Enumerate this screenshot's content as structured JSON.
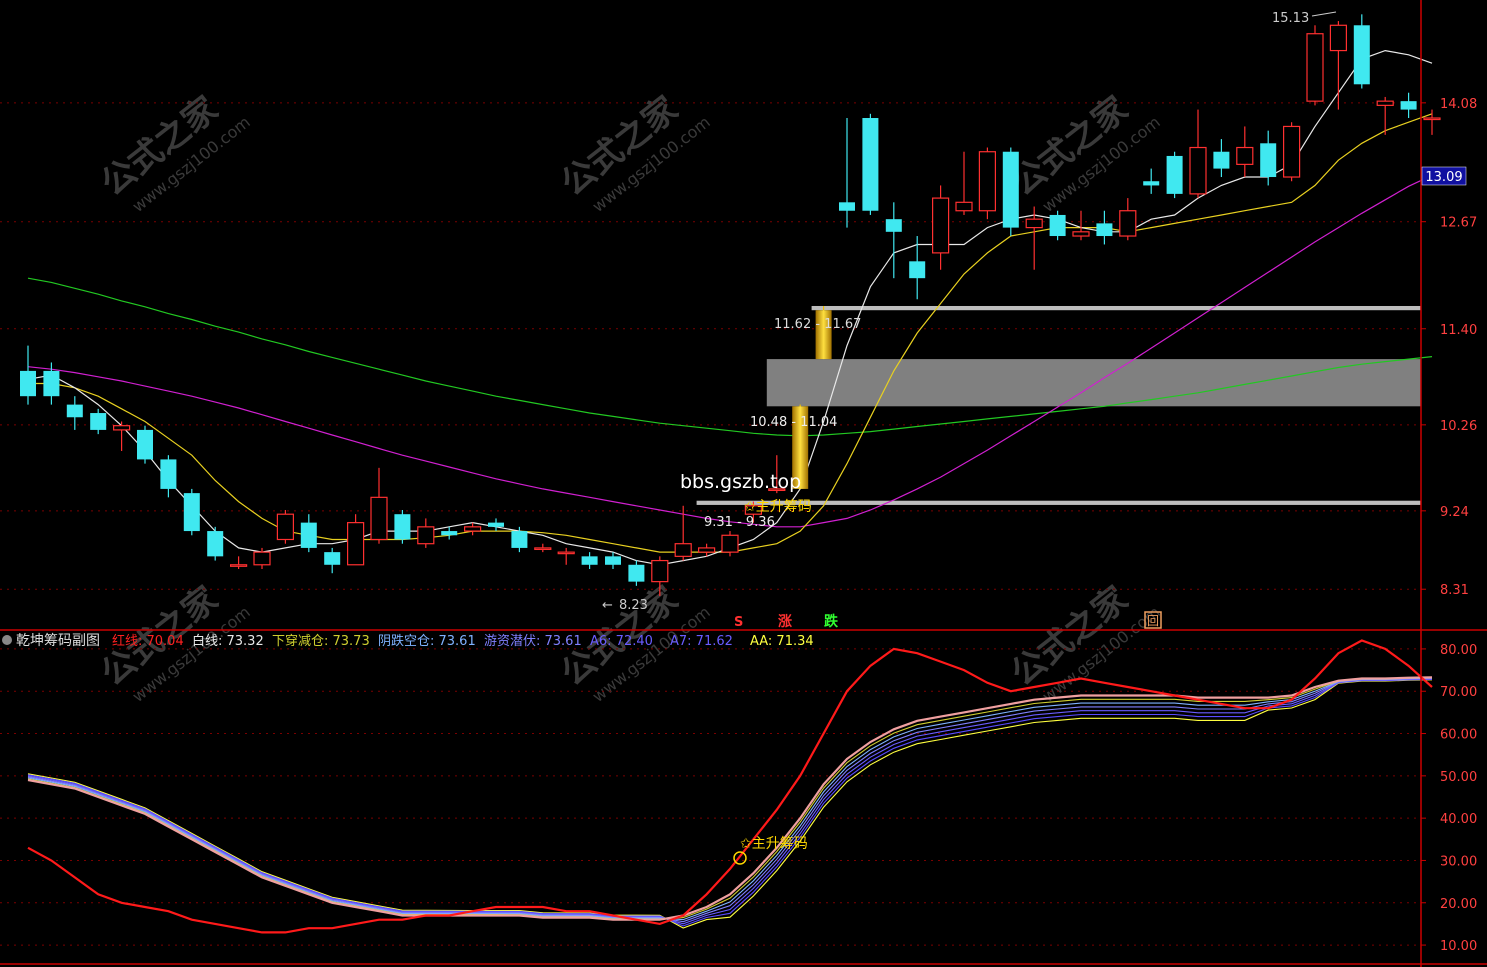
{
  "main": {
    "y_ticks": [
      "14.08",
      "12.67",
      "11.40",
      "10.26",
      "9.24",
      "8.31"
    ],
    "current_price": "13.09",
    "high_label": "15.13",
    "low_label": "8.23",
    "zone_top_label": "11.62 - 11.67",
    "zone_mid_label": "10.48 - 11.04",
    "zone_low_label": "9.31 - 9.36",
    "signal_label": "✩主升筹码",
    "site_text": "bbs.gszb.top",
    "badge_s": "S",
    "badge_up": "涨",
    "badge_down": "跌",
    "badge_back": "回"
  },
  "sub": {
    "title": "乾坤筹码副图",
    "legend": [
      {
        "name": "红线",
        "value": "70.04",
        "color": "#ff2020"
      },
      {
        "name": "白线",
        "value": "73.32",
        "color": "#e8e8e8"
      },
      {
        "name": "下穿减仓",
        "value": "73.73",
        "color": "#cfcf30"
      },
      {
        "name": "阴跌空仓",
        "value": "73.61",
        "color": "#7fb2ff"
      },
      {
        "name": "游资潜伏",
        "value": "73.61",
        "color": "#8080ff"
      },
      {
        "name": "A6",
        "value": "72.40",
        "color": "#6a5cff"
      },
      {
        "name": "A7",
        "value": "71.62",
        "color": "#6a5cff"
      },
      {
        "name": "AA",
        "value": "71.34",
        "color": "#ffff40"
      }
    ],
    "y_ticks": [
      "80.00",
      "70.00",
      "60.00",
      "50.00",
      "40.00",
      "30.00",
      "20.00",
      "10.00"
    ],
    "signal_label": "✩主升筹码"
  },
  "watermark": {
    "brand": "公式之家",
    "url": "www.gszj100.com"
  },
  "chart_data": [
    {
      "type": "candlestick",
      "title": "",
      "y_ticks": [
        14.08,
        12.67,
        11.4,
        10.26,
        9.24,
        8.31
      ],
      "ylim": [
        7.85,
        15.3
      ],
      "high": 15.13,
      "low": 8.23,
      "last": 13.09,
      "zones": [
        [
          11.62,
          11.67
        ],
        [
          10.48,
          11.04
        ],
        [
          9.31,
          9.36
        ]
      ],
      "candles": [
        [
          10.9,
          10.6,
          11.2,
          10.5
        ],
        [
          10.9,
          10.6,
          11.0,
          10.5
        ],
        [
          10.5,
          10.35,
          10.6,
          10.2
        ],
        [
          10.4,
          10.2,
          10.45,
          10.15
        ],
        [
          10.2,
          10.25,
          10.3,
          9.95
        ],
        [
          10.2,
          9.85,
          10.25,
          9.8
        ],
        [
          9.85,
          9.5,
          9.9,
          9.4
        ],
        [
          9.45,
          9.0,
          9.5,
          8.95
        ],
        [
          9.0,
          8.7,
          9.05,
          8.65
        ],
        [
          8.6,
          8.6,
          8.7,
          8.55
        ],
        [
          8.6,
          8.75,
          8.8,
          8.55
        ],
        [
          8.9,
          9.2,
          9.25,
          8.85
        ],
        [
          9.1,
          8.8,
          9.2,
          8.75
        ],
        [
          8.75,
          8.6,
          8.8,
          8.5
        ],
        [
          8.6,
          9.1,
          9.2,
          8.6
        ],
        [
          8.9,
          9.4,
          9.75,
          8.85
        ],
        [
          9.2,
          8.9,
          9.25,
          8.85
        ],
        [
          8.85,
          9.05,
          9.15,
          8.8
        ],
        [
          9.0,
          8.95,
          9.05,
          8.9
        ],
        [
          9.0,
          9.05,
          9.1,
          8.95
        ],
        [
          9.1,
          9.05,
          9.15,
          9.0
        ],
        [
          9.0,
          8.8,
          9.05,
          8.75
        ],
        [
          8.8,
          8.8,
          8.85,
          8.75
        ],
        [
          8.75,
          8.75,
          8.8,
          8.6
        ],
        [
          8.7,
          8.6,
          8.75,
          8.55
        ],
        [
          8.7,
          8.6,
          8.75,
          8.55
        ],
        [
          8.6,
          8.4,
          8.65,
          8.35
        ],
        [
          8.4,
          8.65,
          8.7,
          8.23
        ],
        [
          8.7,
          8.85,
          9.3,
          8.65
        ],
        [
          8.75,
          8.8,
          8.85,
          8.7
        ],
        [
          8.75,
          8.95,
          9.0,
          8.7
        ],
        [
          9.2,
          9.3,
          9.35,
          9.1
        ],
        [
          9.5,
          9.5,
          9.9,
          9.45
        ],
        [
          9.5,
          10.48,
          10.5,
          9.5
        ],
        [
          11.04,
          11.62,
          11.67,
          11.04
        ],
        [
          12.9,
          12.8,
          13.9,
          12.6
        ],
        [
          13.9,
          12.8,
          13.95,
          12.75
        ],
        [
          12.7,
          12.55,
          12.9,
          12.0
        ],
        [
          12.2,
          12.0,
          12.5,
          11.75
        ],
        [
          12.3,
          12.95,
          13.1,
          12.1
        ],
        [
          12.8,
          12.9,
          13.5,
          12.75
        ],
        [
          12.8,
          13.5,
          13.55,
          12.7
        ],
        [
          13.5,
          12.6,
          13.55,
          12.5
        ],
        [
          12.6,
          12.7,
          12.85,
          12.1
        ],
        [
          12.75,
          12.5,
          12.8,
          12.45
        ],
        [
          12.5,
          12.55,
          12.8,
          12.45
        ],
        [
          12.65,
          12.5,
          12.8,
          12.4
        ],
        [
          12.5,
          12.8,
          12.95,
          12.45
        ],
        [
          13.15,
          13.1,
          13.3,
          13.0
        ],
        [
          13.45,
          13.0,
          13.5,
          12.95
        ],
        [
          13.0,
          13.55,
          14.0,
          12.95
        ],
        [
          13.5,
          13.3,
          13.65,
          13.2
        ],
        [
          13.35,
          13.55,
          13.8,
          13.2
        ],
        [
          13.6,
          13.2,
          13.75,
          13.1
        ],
        [
          13.2,
          13.8,
          13.85,
          13.15
        ],
        [
          14.1,
          14.9,
          15.0,
          14.05
        ],
        [
          14.7,
          15.0,
          15.05,
          14.0
        ],
        [
          15.0,
          14.3,
          15.13,
          14.25
        ],
        [
          14.05,
          14.1,
          14.15,
          13.7
        ],
        [
          14.1,
          14.0,
          14.2,
          13.9
        ],
        [
          13.9,
          13.9,
          14.0,
          13.7
        ]
      ],
      "ma_white": [
        10.8,
        10.85,
        10.7,
        10.5,
        10.25,
        9.95,
        9.6,
        9.3,
        9.0,
        8.8,
        8.75,
        8.8,
        8.85,
        8.85,
        8.9,
        9.0,
        9.0,
        9.0,
        9.05,
        9.1,
        9.05,
        9.0,
        8.95,
        8.85,
        8.8,
        8.75,
        8.65,
        8.6,
        8.65,
        8.7,
        8.8,
        8.9,
        9.1,
        9.5,
        10.3,
        11.2,
        11.9,
        12.3,
        12.4,
        12.4,
        12.4,
        12.6,
        12.7,
        12.75,
        12.7,
        12.6,
        12.55,
        12.55,
        12.7,
        12.75,
        12.95,
        13.1,
        13.2,
        13.2,
        13.35,
        13.8,
        14.2,
        14.6,
        14.7,
        14.65,
        14.55
      ],
      "ma_yellow": [
        10.75,
        10.75,
        10.7,
        10.6,
        10.45,
        10.3,
        10.1,
        9.9,
        9.6,
        9.35,
        9.15,
        9.0,
        8.95,
        8.9,
        8.9,
        8.9,
        8.9,
        8.92,
        8.95,
        9.0,
        9.0,
        9.0,
        8.98,
        8.95,
        8.9,
        8.85,
        8.8,
        8.75,
        8.75,
        8.75,
        8.75,
        8.8,
        8.85,
        9.0,
        9.3,
        9.8,
        10.35,
        10.9,
        11.35,
        11.7,
        12.05,
        12.3,
        12.5,
        12.55,
        12.6,
        12.6,
        12.6,
        12.55,
        12.6,
        12.65,
        12.7,
        12.75,
        12.8,
        12.85,
        12.9,
        13.1,
        13.4,
        13.6,
        13.75,
        13.85,
        13.95
      ],
      "ma_magenta": [
        10.95,
        10.92,
        10.88,
        10.83,
        10.78,
        10.72,
        10.66,
        10.6,
        10.53,
        10.46,
        10.38,
        10.3,
        10.22,
        10.14,
        10.06,
        9.98,
        9.9,
        9.83,
        9.76,
        9.69,
        9.62,
        9.56,
        9.5,
        9.45,
        9.4,
        9.35,
        9.3,
        9.25,
        9.2,
        9.15,
        9.11,
        9.08,
        9.05,
        9.05,
        9.1,
        9.15,
        9.25,
        9.37,
        9.5,
        9.64,
        9.8,
        9.96,
        10.13,
        10.3,
        10.47,
        10.64,
        10.82,
        10.99,
        11.17,
        11.35,
        11.53,
        11.71,
        11.89,
        12.07,
        12.25,
        12.43,
        12.6,
        12.77,
        12.93,
        13.09,
        13.22
      ],
      "ma_green": [
        12.0,
        11.95,
        11.88,
        11.81,
        11.73,
        11.66,
        11.58,
        11.51,
        11.43,
        11.36,
        11.28,
        11.21,
        11.13,
        11.06,
        10.99,
        10.92,
        10.85,
        10.78,
        10.72,
        10.66,
        10.6,
        10.55,
        10.5,
        10.45,
        10.4,
        10.36,
        10.32,
        10.28,
        10.25,
        10.22,
        10.19,
        10.16,
        10.14,
        10.13,
        10.14,
        10.16,
        10.18,
        10.21,
        10.24,
        10.27,
        10.3,
        10.33,
        10.36,
        10.39,
        10.42,
        10.45,
        10.48,
        10.52,
        10.56,
        10.6,
        10.64,
        10.69,
        10.74,
        10.79,
        10.84,
        10.89,
        10.94,
        10.98,
        11.01,
        11.04,
        11.07
      ]
    },
    {
      "type": "line",
      "title": "乾坤筹码副图",
      "y_ticks": [
        80,
        70,
        60,
        50,
        40,
        30,
        20,
        10
      ],
      "ylim": [
        6,
        84
      ],
      "red": [
        33,
        30,
        26,
        22,
        20,
        19,
        18,
        16,
        15,
        14,
        13,
        13,
        14,
        14,
        15,
        16,
        16,
        17,
        17,
        18,
        19,
        19,
        19,
        18,
        18,
        17,
        16,
        15,
        17,
        22,
        28,
        35,
        42,
        50,
        60,
        70,
        76,
        80,
        79,
        77,
        75,
        72,
        70,
        71,
        72,
        73,
        72,
        71,
        70,
        69,
        68,
        67,
        66,
        66,
        68,
        73,
        79,
        82,
        80,
        76,
        71
      ],
      "white": [
        49,
        48,
        47,
        45,
        43,
        41,
        38,
        35,
        32,
        29,
        26,
        24,
        22,
        20,
        19,
        18,
        17,
        17,
        17,
        17,
        17,
        17,
        16.5,
        16.5,
        16.5,
        16,
        16,
        16,
        17,
        19,
        22,
        27,
        33,
        40,
        48,
        54,
        58,
        61,
        63,
        64,
        65,
        66,
        67,
        68,
        68.5,
        69,
        69,
        69,
        69,
        69,
        68.5,
        68.5,
        68.5,
        68.5,
        69,
        71,
        72.5,
        73,
        73,
        73.2,
        73.3
      ],
      "bundle_offsets": [
        0,
        1.5,
        3,
        4.5,
        6,
        7.5,
        9
      ],
      "bundle_colors": [
        "#e8e8e8",
        "#cfcf30",
        "#7fb2ff",
        "#8080ff",
        "#6a5cff",
        "#5a4cff",
        "#ffff40"
      ]
    }
  ]
}
